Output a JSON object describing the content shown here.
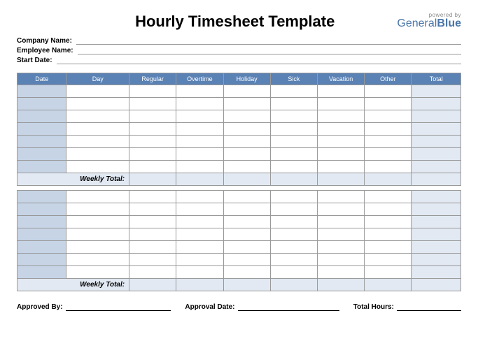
{
  "title": "Hourly Timesheet Template",
  "brand": {
    "powered": "powered by",
    "general": "General",
    "blue": "Blue"
  },
  "meta": {
    "company_label": "Company Name:",
    "employee_label": "Employee Name:",
    "start_label": "Start Date:"
  },
  "columns": {
    "date": "Date",
    "day": "Day",
    "regular": "Regular",
    "overtime": "Overtime",
    "holiday": "Holiday",
    "sick": "Sick",
    "vacation": "Vacation",
    "other": "Other",
    "total": "Total"
  },
  "weekly_total_label": "Weekly Total:",
  "footer": {
    "approved_by": "Approved By:",
    "approval_date": "Approval Date:",
    "total_hours": "Total Hours:"
  }
}
